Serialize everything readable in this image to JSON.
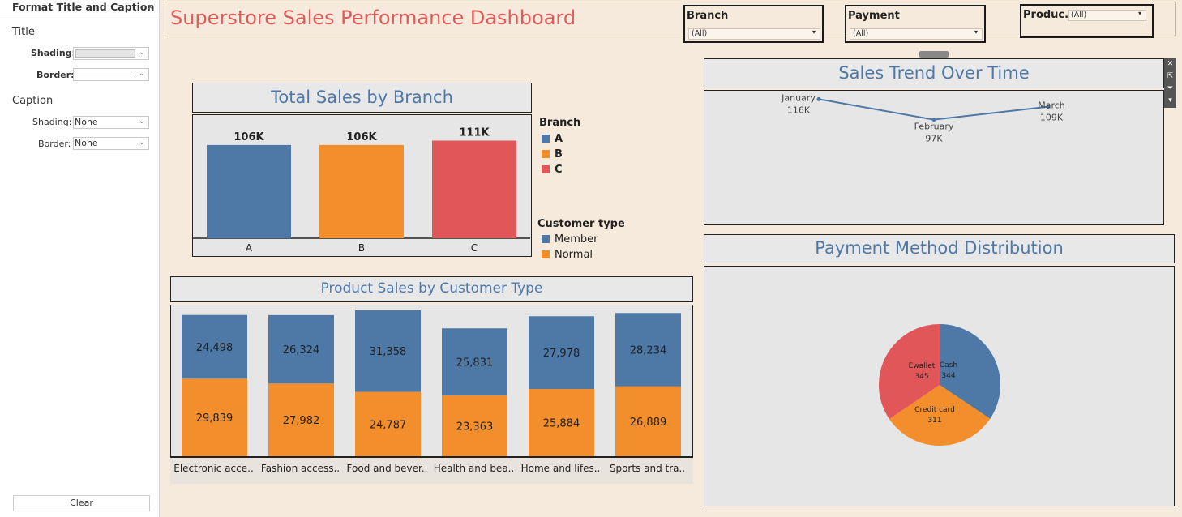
{
  "format_panel": {
    "title": "Format Title and Caption",
    "close": "×",
    "title_section": "Title",
    "shading_label": "Shading:",
    "border_label": "Border:",
    "caption_section": "Caption",
    "caption_shading_label": "Shading:",
    "caption_shading_value": "None",
    "caption_border_label": "Border:",
    "caption_border_value": "None",
    "clear_label": "Clear"
  },
  "dashboard": {
    "title": "Superstore Sales Performance Dashboard",
    "filters": [
      {
        "label": "Branch",
        "value": "(All)"
      },
      {
        "label": "Payment",
        "value": "(All)"
      },
      {
        "label": "Produc..",
        "value": "(All)"
      }
    ]
  },
  "colors": {
    "blue": "#4e79a7",
    "orange": "#f28e2b",
    "red": "#e15759",
    "title_red": "#e05a5a",
    "title_blue": "#4e79a7"
  },
  "branch_chart": {
    "title": "Total Sales by Branch",
    "legend_branch_title": "Branch",
    "legend_branch": [
      "A",
      "B",
      "C"
    ],
    "legend_customer_title": "Customer type",
    "legend_customer": [
      "Member",
      "Normal"
    ]
  },
  "trend_chart": {
    "title": "Sales Trend Over Time"
  },
  "payment_chart": {
    "title": "Payment Method Distribution"
  },
  "product_chart": {
    "title": "Product Sales by Customer Type"
  },
  "toolbar_icons": [
    "close-icon",
    "popout-icon",
    "filter-icon",
    "more-icon"
  ],
  "chart_data": [
    {
      "type": "bar",
      "title": "Total Sales by Branch",
      "categories": [
        "A",
        "B",
        "C"
      ],
      "values": [
        106000,
        106000,
        111000
      ],
      "labels": [
        "106K",
        "106K",
        "111K"
      ],
      "colors": [
        "#4e79a7",
        "#f28e2b",
        "#e15759"
      ],
      "ylim": [
        0,
        140000
      ]
    },
    {
      "type": "line",
      "title": "Sales Trend Over Time",
      "x": [
        "January",
        "February",
        "March"
      ],
      "values": [
        116000,
        97000,
        109000
      ],
      "labels": [
        "116K",
        "97K",
        "109K"
      ]
    },
    {
      "type": "pie",
      "title": "Payment Method Distribution",
      "categories": [
        "Cash",
        "Credit card",
        "Ewallet"
      ],
      "values": [
        344,
        311,
        345
      ],
      "colors": [
        "#4e79a7",
        "#f28e2b",
        "#e15759"
      ]
    },
    {
      "type": "bar",
      "stacked": true,
      "title": "Product Sales by Customer Type",
      "categories": [
        "Electronic acce..",
        "Fashion access..",
        "Food and bever..",
        "Health and bea..",
        "Home and lifes..",
        "Sports and tra.."
      ],
      "series": [
        {
          "name": "Member",
          "values": [
            24498,
            26324,
            31358,
            25831,
            27978,
            28234
          ],
          "labels": [
            "24,498",
            "26,324",
            "31,358",
            "25,831",
            "27,978",
            "28,234"
          ]
        },
        {
          "name": "Normal",
          "values": [
            29839,
            27982,
            24787,
            23363,
            25884,
            26889
          ],
          "labels": [
            "29,839",
            "27,982",
            "24,787",
            "23,363",
            "25,884",
            "26,889"
          ]
        }
      ],
      "ylim": [
        0,
        58000
      ]
    }
  ]
}
